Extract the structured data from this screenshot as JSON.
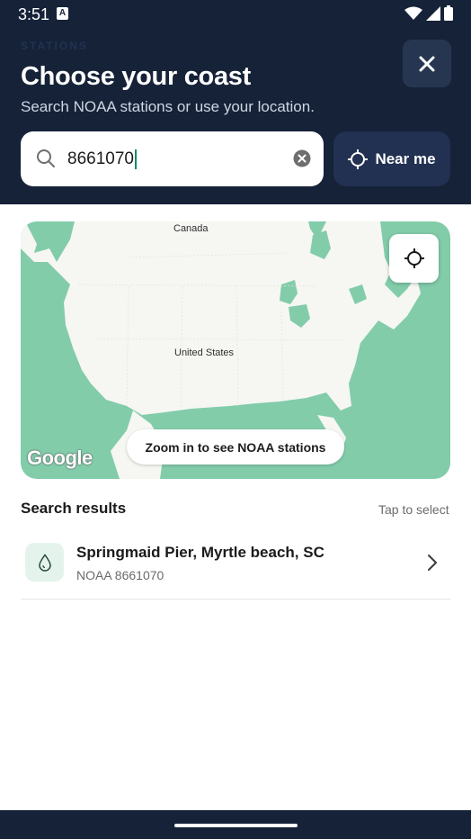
{
  "status_bar": {
    "time": "3:51",
    "notification_badge": "A"
  },
  "header": {
    "eyebrow": "STATIONS",
    "title": "Choose your coast",
    "subtitle": "Search NOAA stations or use your location."
  },
  "search": {
    "value": "8661070"
  },
  "near_me": {
    "label": "Near me"
  },
  "map": {
    "label_canada": "Canada",
    "label_us": "United States",
    "zoom_hint": "Zoom in to see NOAA stations",
    "attribution": "Google"
  },
  "results": {
    "title": "Search results",
    "hint": "Tap to select",
    "items": [
      {
        "name": "Springmaid Pier, Myrtle beach, SC",
        "subtitle": "NOAA 8661070"
      }
    ]
  },
  "colors": {
    "header_bg": "#152238",
    "map_water": "#82ccaa",
    "accent": "#0d8a6a"
  }
}
